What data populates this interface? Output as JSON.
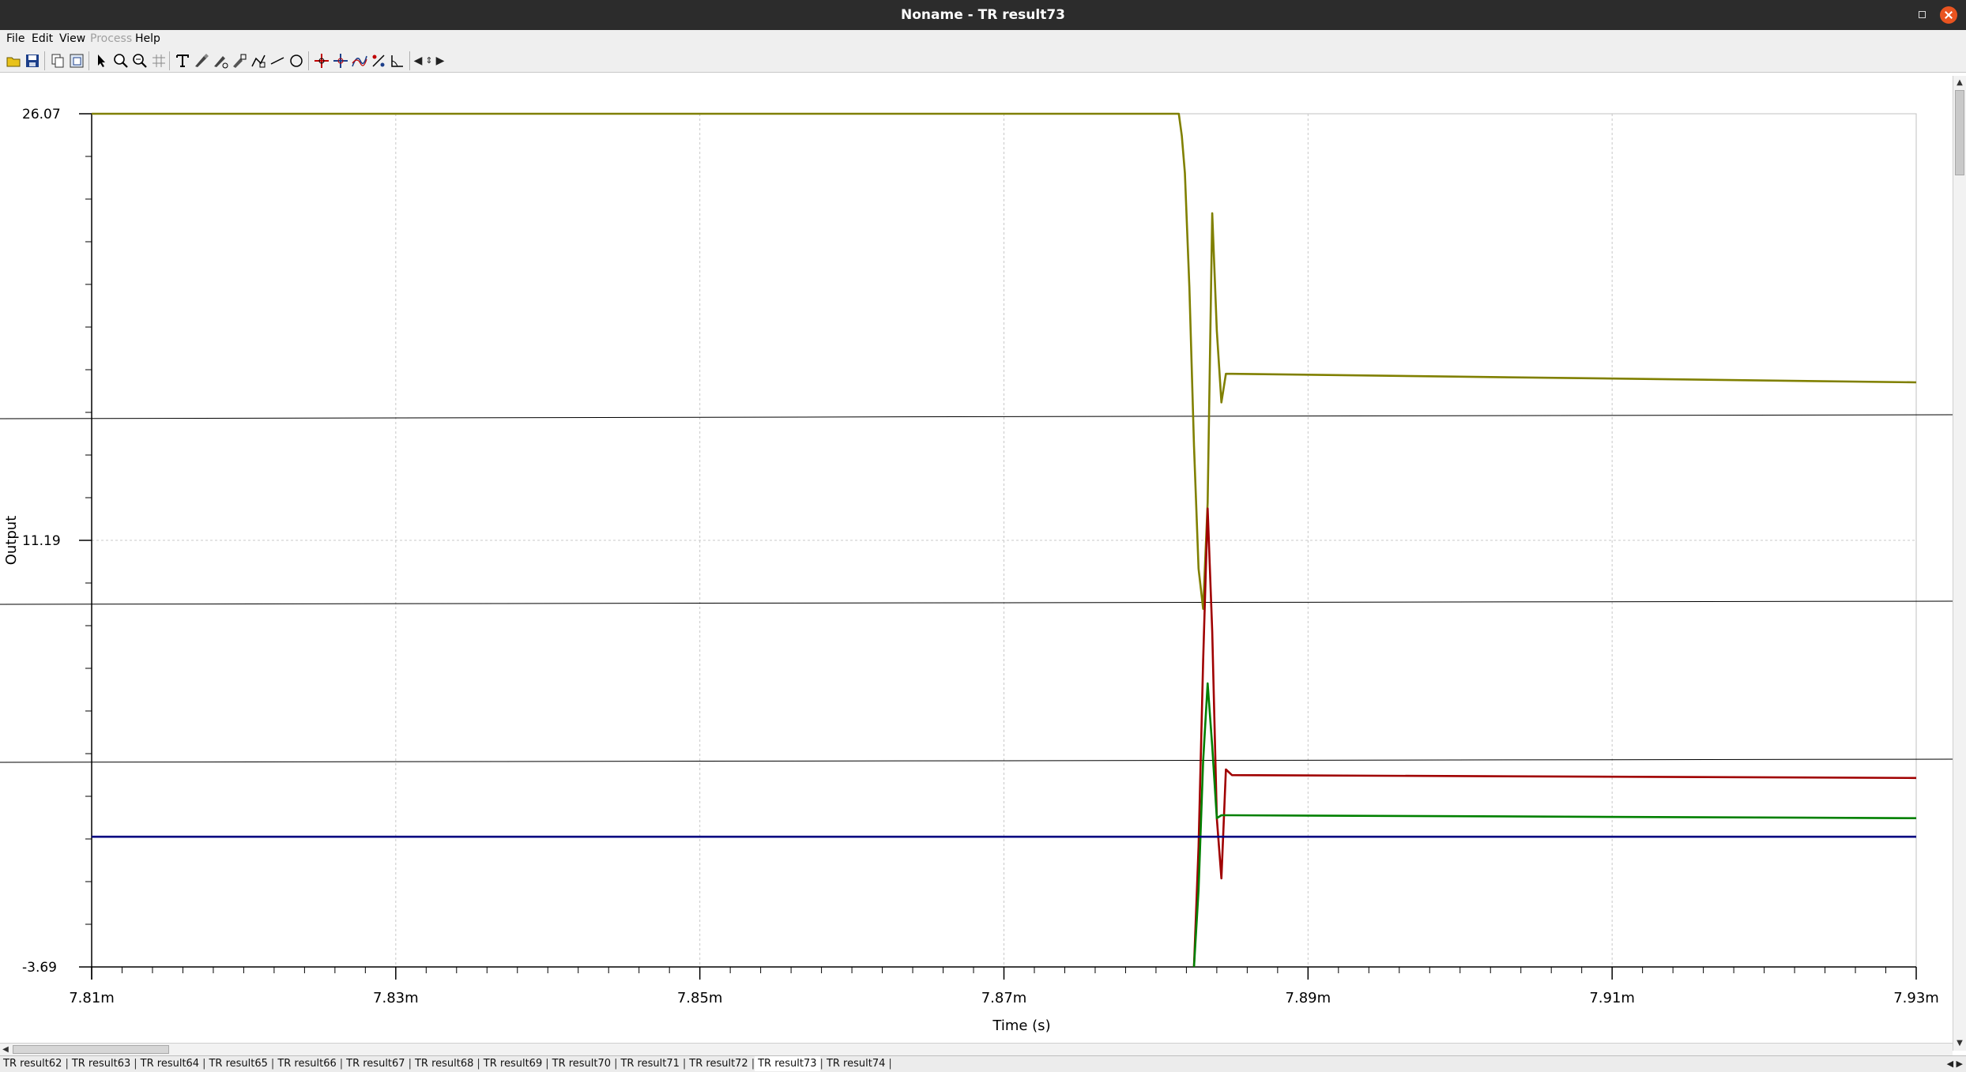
{
  "window": {
    "title": "Noname - TR result73"
  },
  "menu": {
    "items": [
      {
        "label": "File",
        "enabled": true
      },
      {
        "label": "Edit",
        "enabled": true
      },
      {
        "label": "View",
        "enabled": true
      },
      {
        "label": "Process",
        "enabled": false
      },
      {
        "label": "Help",
        "enabled": true
      }
    ]
  },
  "toolbar": {
    "tools": [
      "open-folder-icon",
      "save-icon",
      "copy-icon",
      "copy-image-icon",
      "pointer-icon",
      "zoom-in-icon",
      "zoom-fit-icon",
      "grid-icon",
      "text-icon",
      "marker-icon",
      "marker-edit-icon",
      "marker-style-icon",
      "polyline-icon",
      "line-icon",
      "circle-icon",
      "cursor-a-icon",
      "cursor-b-icon",
      "curve-fit-icon",
      "measure-icon",
      "angle-icon",
      "arrow-left-icon",
      "arrow-updown-icon",
      "arrow-right-icon"
    ]
  },
  "chart_data": {
    "type": "line",
    "title": "",
    "xlabel": "Time (s)",
    "ylabel": "Output",
    "xlim": [
      7.81,
      7.93
    ],
    "x_unit": "m",
    "ylim": [
      -3.69,
      26.07
    ],
    "x_ticks": [
      "7.81m",
      "7.83m",
      "7.85m",
      "7.87m",
      "7.89m",
      "7.91m",
      "7.93m"
    ],
    "y_ticks": [
      "26.07",
      "11.19",
      "-3.69"
    ],
    "grid": true,
    "series": [
      {
        "color": "#808000",
        "x": [
          7.81,
          7.8815,
          7.8817,
          7.8819,
          7.8822,
          7.8825,
          7.8828,
          7.8831,
          7.8834,
          7.8837,
          7.884,
          7.8843,
          7.8846,
          7.885,
          7.9,
          7.93
        ],
        "y": [
          26.07,
          26.07,
          25.3,
          24.0,
          20.0,
          14.5,
          10.2,
          8.8,
          12.5,
          22.6,
          18.5,
          16.0,
          17.0,
          17.0,
          16.9,
          16.7
        ]
      },
      {
        "color": "#a00000",
        "x": [
          7.8825,
          7.8828,
          7.8831,
          7.8834,
          7.8837,
          7.884,
          7.8843,
          7.8846,
          7.885,
          7.93
        ],
        "y": [
          -3.69,
          0.5,
          7.0,
          12.3,
          8.0,
          1.5,
          -0.6,
          3.2,
          3.0,
          2.9
        ]
      },
      {
        "color": "#008000",
        "x": [
          7.8825,
          7.8828,
          7.8831,
          7.8834,
          7.8837,
          7.884,
          7.8843,
          7.8846,
          7.885,
          7.93
        ],
        "y": [
          -3.69,
          -1.0,
          3.5,
          6.2,
          4.0,
          1.5,
          1.6,
          1.6,
          1.6,
          1.5
        ]
      },
      {
        "color": "#000080",
        "x": [
          7.81,
          7.93
        ],
        "y": [
          0.85,
          0.85
        ]
      }
    ]
  },
  "tabs": {
    "items": [
      "TR result62",
      "TR result63",
      "TR result64",
      "TR result65",
      "TR result66",
      "TR result67",
      "TR result68",
      "TR result69",
      "TR result70",
      "TR result71",
      "TR result72",
      "TR result73",
      "TR result74"
    ],
    "active": "TR result73"
  }
}
